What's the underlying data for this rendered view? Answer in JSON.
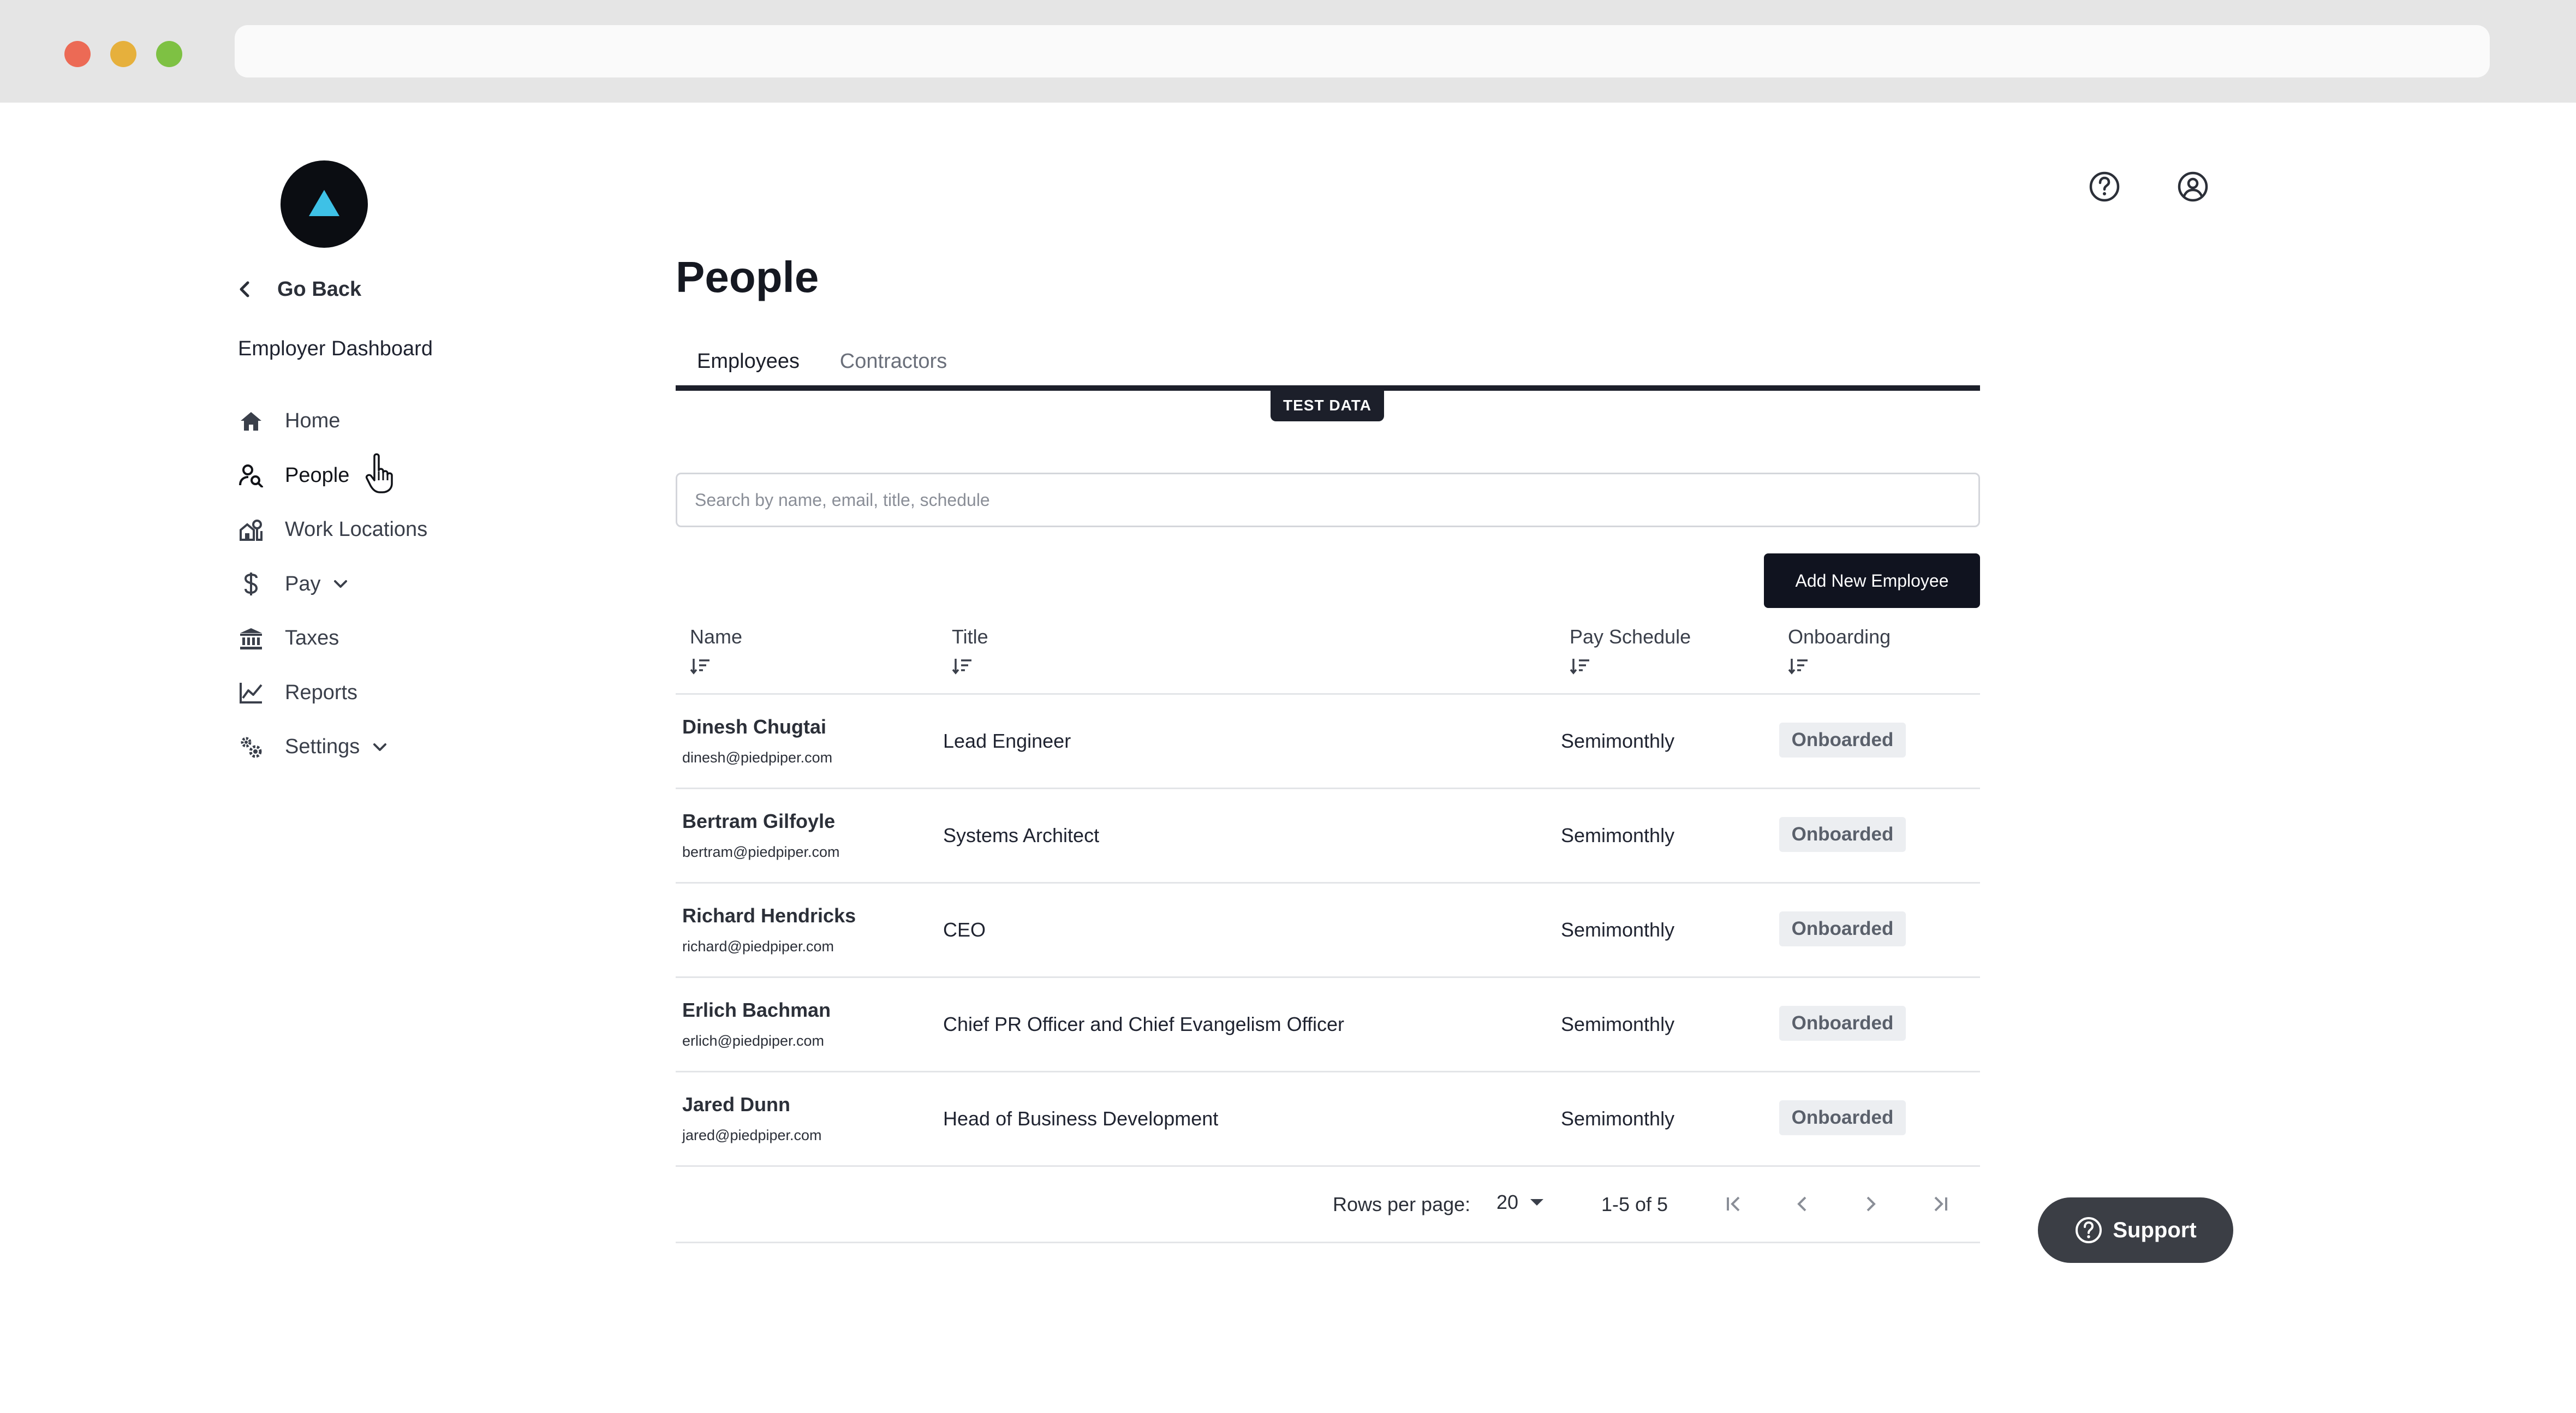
{
  "sidebar": {
    "go_back": "Go Back",
    "section_title": "Employer Dashboard",
    "items": [
      {
        "label": "Home"
      },
      {
        "label": "People"
      },
      {
        "label": "Work Locations"
      },
      {
        "label": "Pay"
      },
      {
        "label": "Taxes"
      },
      {
        "label": "Reports"
      },
      {
        "label": "Settings"
      }
    ]
  },
  "main": {
    "title": "People",
    "tabs": [
      {
        "label": "Employees",
        "active": true
      },
      {
        "label": "Contractors",
        "active": false
      }
    ],
    "test_badge": "TEST DATA",
    "search": {
      "placeholder": "Search by name, email, title, schedule",
      "value": ""
    },
    "add_button": "Add New Employee",
    "table": {
      "columns": [
        "Name",
        "Title",
        "Pay Schedule",
        "Onboarding"
      ],
      "rows": [
        {
          "name": "Dinesh Chugtai",
          "email": "dinesh@piedpiper.com",
          "title": "Lead Engineer",
          "schedule": "Semimonthly",
          "status": "Onboarded"
        },
        {
          "name": "Bertram Gilfoyle",
          "email": "bertram@piedpiper.com",
          "title": "Systems Architect",
          "schedule": "Semimonthly",
          "status": "Onboarded"
        },
        {
          "name": "Richard Hendricks",
          "email": "richard@piedpiper.com",
          "title": "CEO",
          "schedule": "Semimonthly",
          "status": "Onboarded"
        },
        {
          "name": "Erlich Bachman",
          "email": "erlich@piedpiper.com",
          "title": "Chief PR Officer and Chief Evangelism Officer",
          "schedule": "Semimonthly",
          "status": "Onboarded"
        },
        {
          "name": "Jared Dunn",
          "email": "jared@piedpiper.com",
          "title": "Head of Business Development",
          "schedule": "Semimonthly",
          "status": "Onboarded"
        }
      ]
    },
    "pagination": {
      "rows_label": "Rows per page:",
      "rows_value": "20",
      "range": "1-5 of 5"
    }
  },
  "support": {
    "label": "Support"
  },
  "colors": {
    "primary": "#10131f",
    "accent": "#3ec1e6",
    "badge_bg": "#eceef1"
  },
  "icons": [
    "logo-triangle-icon",
    "chevron-left-icon",
    "home-icon",
    "people-search-icon",
    "work-locations-icon",
    "dollar-icon",
    "chevron-down-icon",
    "bank-icon",
    "chart-line-icon",
    "gears-icon",
    "help-icon",
    "account-icon",
    "sort-icon",
    "first-page-icon",
    "prev-page-icon",
    "next-page-icon",
    "last-page-icon",
    "support-help-icon",
    "hand-cursor-icon"
  ]
}
